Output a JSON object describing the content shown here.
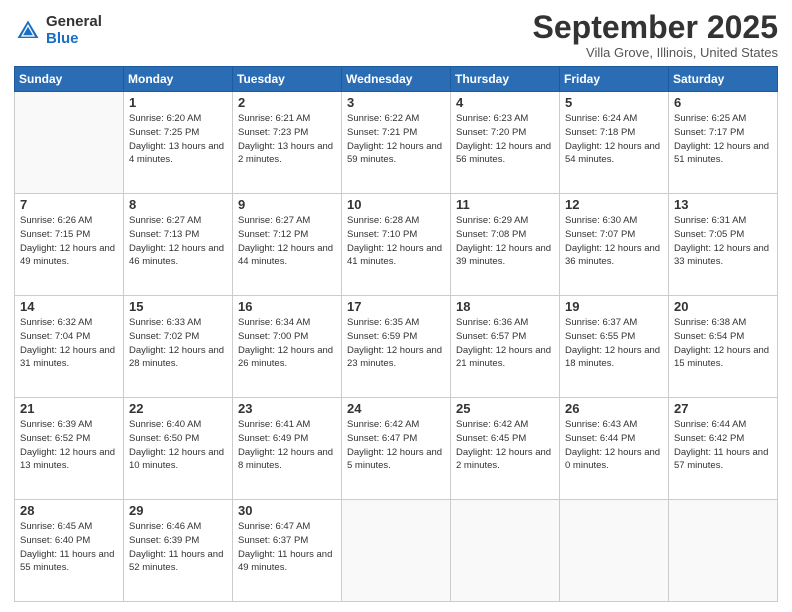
{
  "logo": {
    "general": "General",
    "blue": "Blue"
  },
  "header": {
    "month": "September 2025",
    "location": "Villa Grove, Illinois, United States"
  },
  "days_of_week": [
    "Sunday",
    "Monday",
    "Tuesday",
    "Wednesday",
    "Thursday",
    "Friday",
    "Saturday"
  ],
  "weeks": [
    [
      {
        "day": "",
        "sunrise": "",
        "sunset": "",
        "daylight": "",
        "empty": true
      },
      {
        "day": "1",
        "sunrise": "Sunrise: 6:20 AM",
        "sunset": "Sunset: 7:25 PM",
        "daylight": "Daylight: 13 hours and 4 minutes."
      },
      {
        "day": "2",
        "sunrise": "Sunrise: 6:21 AM",
        "sunset": "Sunset: 7:23 PM",
        "daylight": "Daylight: 13 hours and 2 minutes."
      },
      {
        "day": "3",
        "sunrise": "Sunrise: 6:22 AM",
        "sunset": "Sunset: 7:21 PM",
        "daylight": "Daylight: 12 hours and 59 minutes."
      },
      {
        "day": "4",
        "sunrise": "Sunrise: 6:23 AM",
        "sunset": "Sunset: 7:20 PM",
        "daylight": "Daylight: 12 hours and 56 minutes."
      },
      {
        "day": "5",
        "sunrise": "Sunrise: 6:24 AM",
        "sunset": "Sunset: 7:18 PM",
        "daylight": "Daylight: 12 hours and 54 minutes."
      },
      {
        "day": "6",
        "sunrise": "Sunrise: 6:25 AM",
        "sunset": "Sunset: 7:17 PM",
        "daylight": "Daylight: 12 hours and 51 minutes."
      }
    ],
    [
      {
        "day": "7",
        "sunrise": "Sunrise: 6:26 AM",
        "sunset": "Sunset: 7:15 PM",
        "daylight": "Daylight: 12 hours and 49 minutes."
      },
      {
        "day": "8",
        "sunrise": "Sunrise: 6:27 AM",
        "sunset": "Sunset: 7:13 PM",
        "daylight": "Daylight: 12 hours and 46 minutes."
      },
      {
        "day": "9",
        "sunrise": "Sunrise: 6:27 AM",
        "sunset": "Sunset: 7:12 PM",
        "daylight": "Daylight: 12 hours and 44 minutes."
      },
      {
        "day": "10",
        "sunrise": "Sunrise: 6:28 AM",
        "sunset": "Sunset: 7:10 PM",
        "daylight": "Daylight: 12 hours and 41 minutes."
      },
      {
        "day": "11",
        "sunrise": "Sunrise: 6:29 AM",
        "sunset": "Sunset: 7:08 PM",
        "daylight": "Daylight: 12 hours and 39 minutes."
      },
      {
        "day": "12",
        "sunrise": "Sunrise: 6:30 AM",
        "sunset": "Sunset: 7:07 PM",
        "daylight": "Daylight: 12 hours and 36 minutes."
      },
      {
        "day": "13",
        "sunrise": "Sunrise: 6:31 AM",
        "sunset": "Sunset: 7:05 PM",
        "daylight": "Daylight: 12 hours and 33 minutes."
      }
    ],
    [
      {
        "day": "14",
        "sunrise": "Sunrise: 6:32 AM",
        "sunset": "Sunset: 7:04 PM",
        "daylight": "Daylight: 12 hours and 31 minutes."
      },
      {
        "day": "15",
        "sunrise": "Sunrise: 6:33 AM",
        "sunset": "Sunset: 7:02 PM",
        "daylight": "Daylight: 12 hours and 28 minutes."
      },
      {
        "day": "16",
        "sunrise": "Sunrise: 6:34 AM",
        "sunset": "Sunset: 7:00 PM",
        "daylight": "Daylight: 12 hours and 26 minutes."
      },
      {
        "day": "17",
        "sunrise": "Sunrise: 6:35 AM",
        "sunset": "Sunset: 6:59 PM",
        "daylight": "Daylight: 12 hours and 23 minutes."
      },
      {
        "day": "18",
        "sunrise": "Sunrise: 6:36 AM",
        "sunset": "Sunset: 6:57 PM",
        "daylight": "Daylight: 12 hours and 21 minutes."
      },
      {
        "day": "19",
        "sunrise": "Sunrise: 6:37 AM",
        "sunset": "Sunset: 6:55 PM",
        "daylight": "Daylight: 12 hours and 18 minutes."
      },
      {
        "day": "20",
        "sunrise": "Sunrise: 6:38 AM",
        "sunset": "Sunset: 6:54 PM",
        "daylight": "Daylight: 12 hours and 15 minutes."
      }
    ],
    [
      {
        "day": "21",
        "sunrise": "Sunrise: 6:39 AM",
        "sunset": "Sunset: 6:52 PM",
        "daylight": "Daylight: 12 hours and 13 minutes."
      },
      {
        "day": "22",
        "sunrise": "Sunrise: 6:40 AM",
        "sunset": "Sunset: 6:50 PM",
        "daylight": "Daylight: 12 hours and 10 minutes."
      },
      {
        "day": "23",
        "sunrise": "Sunrise: 6:41 AM",
        "sunset": "Sunset: 6:49 PM",
        "daylight": "Daylight: 12 hours and 8 minutes."
      },
      {
        "day": "24",
        "sunrise": "Sunrise: 6:42 AM",
        "sunset": "Sunset: 6:47 PM",
        "daylight": "Daylight: 12 hours and 5 minutes."
      },
      {
        "day": "25",
        "sunrise": "Sunrise: 6:42 AM",
        "sunset": "Sunset: 6:45 PM",
        "daylight": "Daylight: 12 hours and 2 minutes."
      },
      {
        "day": "26",
        "sunrise": "Sunrise: 6:43 AM",
        "sunset": "Sunset: 6:44 PM",
        "daylight": "Daylight: 12 hours and 0 minutes."
      },
      {
        "day": "27",
        "sunrise": "Sunrise: 6:44 AM",
        "sunset": "Sunset: 6:42 PM",
        "daylight": "Daylight: 11 hours and 57 minutes."
      }
    ],
    [
      {
        "day": "28",
        "sunrise": "Sunrise: 6:45 AM",
        "sunset": "Sunset: 6:40 PM",
        "daylight": "Daylight: 11 hours and 55 minutes."
      },
      {
        "day": "29",
        "sunrise": "Sunrise: 6:46 AM",
        "sunset": "Sunset: 6:39 PM",
        "daylight": "Daylight: 11 hours and 52 minutes."
      },
      {
        "day": "30",
        "sunrise": "Sunrise: 6:47 AM",
        "sunset": "Sunset: 6:37 PM",
        "daylight": "Daylight: 11 hours and 49 minutes."
      },
      {
        "day": "",
        "sunrise": "",
        "sunset": "",
        "daylight": "",
        "empty": true
      },
      {
        "day": "",
        "sunrise": "",
        "sunset": "",
        "daylight": "",
        "empty": true
      },
      {
        "day": "",
        "sunrise": "",
        "sunset": "",
        "daylight": "",
        "empty": true
      },
      {
        "day": "",
        "sunrise": "",
        "sunset": "",
        "daylight": "",
        "empty": true
      }
    ]
  ]
}
